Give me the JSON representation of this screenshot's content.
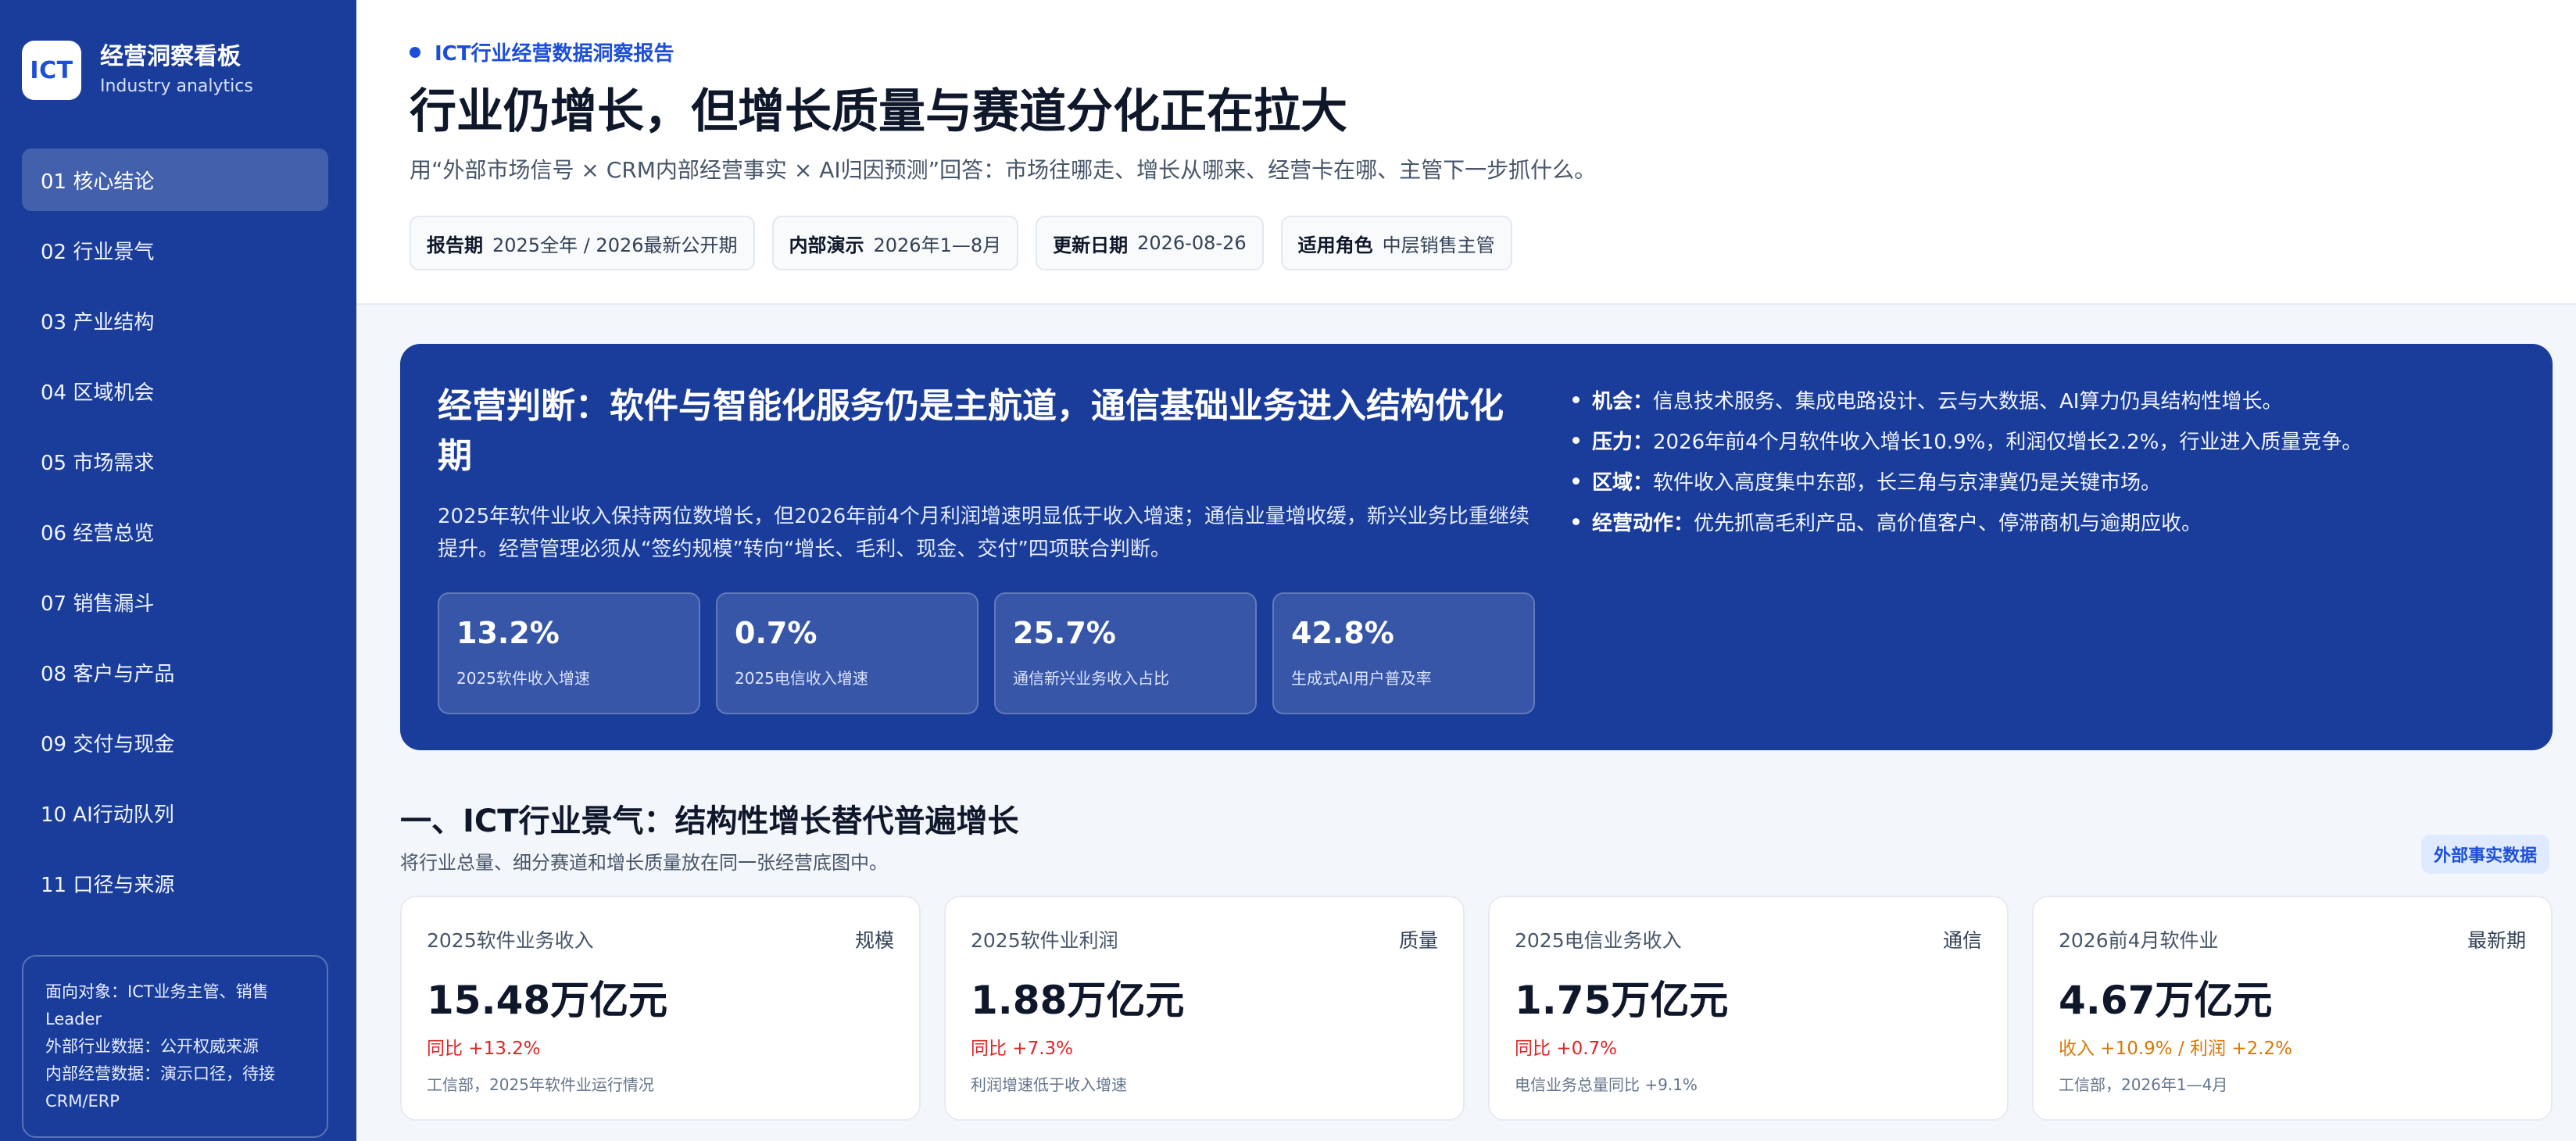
{
  "sidebar": {
    "logo": "ICT",
    "title": "经营洞察看板",
    "subtitle": "Industry analytics",
    "items": [
      {
        "label": "01 核心结论",
        "active": true
      },
      {
        "label": "02 行业景气"
      },
      {
        "label": "03 产业结构"
      },
      {
        "label": "04 区域机会"
      },
      {
        "label": "05 市场需求"
      },
      {
        "label": "06 经营总览"
      },
      {
        "label": "07 销售漏斗"
      },
      {
        "label": "08 客户与产品"
      },
      {
        "label": "09 交付与现金"
      },
      {
        "label": "10 AI行动队列"
      },
      {
        "label": "11 口径与来源"
      }
    ],
    "note_lines": [
      "面向对象：ICT业务主管、销售Leader",
      "外部行业数据：公开权威来源",
      "内部经营数据：演示口径，待接CRM/ERP"
    ]
  },
  "header": {
    "eyebrow": "ICT行业经营数据洞察报告",
    "title": "行业仍增长，但增长质量与赛道分化正在拉大",
    "subtitle": "用“外部市场信号 × CRM内部经营事实 × AI归因预测”回答：市场往哪走、增长从哪来、经营卡在哪、主管下一步抓什么。",
    "meta": [
      {
        "key": "报告期",
        "value": "2025全年 / 2026最新公开期"
      },
      {
        "key": "内部演示",
        "value": "2026年1—8月"
      },
      {
        "key": "更新日期",
        "value": "2026-08-26"
      },
      {
        "key": "适用角色",
        "value": "中层销售主管"
      }
    ]
  },
  "hero": {
    "title": "经营判断：软件与智能化服务仍是主航道，通信基础业务进入结构优化期",
    "desc": "2025年软件业收入保持两位数增长，但2026年前4个月利润增速明显低于收入增速；通信业量增收缓，新兴业务比重继续提升。经营管理必须从“签约规模”转向“增长、毛利、现金、交付”四项联合判断。",
    "kpis": [
      {
        "value": "13.2%",
        "label": "2025软件收入增速"
      },
      {
        "value": "0.7%",
        "label": "2025电信收入增速"
      },
      {
        "value": "25.7%",
        "label": "通信新兴业务收入占比"
      },
      {
        "value": "42.8%",
        "label": "生成式AI用户普及率"
      }
    ],
    "bullets": [
      {
        "key": "机会：",
        "text": "信息技术服务、集成电路设计、云与大数据、AI算力仍具结构性增长。"
      },
      {
        "key": "压力：",
        "text": "2026年前4个月软件收入增长10.9%，利润仅增长2.2%，行业进入质量竞争。"
      },
      {
        "key": "区域：",
        "text": "软件收入高度集中东部，长三角与京津冀仍是关键市场。"
      },
      {
        "key": "经营动作：",
        "text": "优先抓高毛利产品、高价值客户、停滞商机与逾期应收。"
      }
    ]
  },
  "section": {
    "title": "一、ICT行业景气：结构性增长替代普遍增长",
    "subtitle": "将行业总量、细分赛道和增长质量放在同一张经营底图中。",
    "badge": "外部事实数据",
    "cards": [
      {
        "label": "2025软件业务收入",
        "tag": "规模",
        "value": "15.48万亿元",
        "change": "同比 +13.2%",
        "tone": "red",
        "note": "工信部，2025年软件业运行情况"
      },
      {
        "label": "2025软件业利润",
        "tag": "质量",
        "value": "1.88万亿元",
        "change": "同比 +7.3%",
        "tone": "red",
        "note": "利润增速低于收入增速"
      },
      {
        "label": "2025电信业务收入",
        "tag": "通信",
        "value": "1.75万亿元",
        "change": "同比 +0.7%",
        "tone": "red",
        "note": "电信业务总量同比 +9.1%"
      },
      {
        "label": "2026前4月软件业",
        "tag": "最新期",
        "value": "4.67万亿元",
        "change": "收入 +10.9% / 利润 +2.2%",
        "tone": "orange",
        "note": "工信部，2026年1—4月"
      }
    ]
  },
  "colors": {
    "sidebar_bg": "#1a3d9b",
    "hero_bg": "#1a3d9b",
    "accent": "#1d4ed8",
    "positive_red": "#dc2626",
    "warning_orange": "#d97706"
  }
}
